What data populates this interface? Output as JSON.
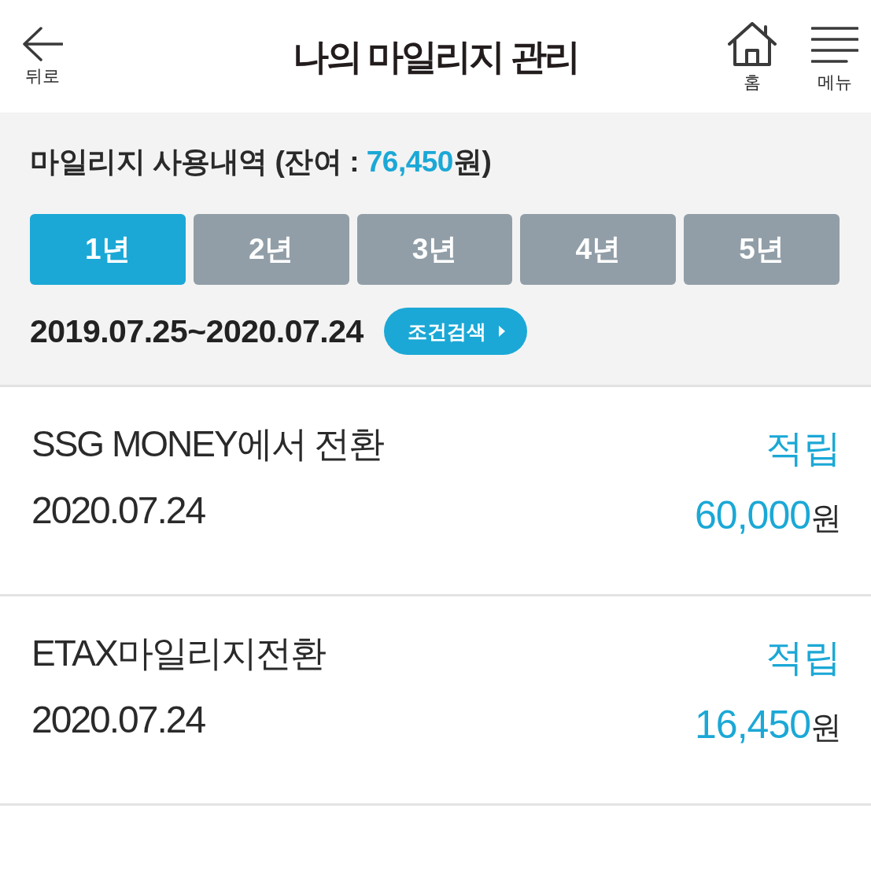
{
  "header": {
    "back_label": "뒤로",
    "title": "나의 마일리지 관리",
    "home_label": "홈",
    "menu_label": "메뉴"
  },
  "summary": {
    "heading": "마일리지 사용내역 (잔여 :",
    "balance": "76,450",
    "balance_end": "원)"
  },
  "periods": [
    {
      "label": "1년",
      "selected": true
    },
    {
      "label": "2년",
      "selected": false
    },
    {
      "label": "3년",
      "selected": false
    },
    {
      "label": "4년",
      "selected": false
    },
    {
      "label": "5년",
      "selected": false
    }
  ],
  "date_range": "2019.07.25~2020.07.24",
  "search_button": "조건검색",
  "transactions": [
    {
      "title": "SSG MONEY에서 전환",
      "date": "2020.07.24",
      "label": "적립",
      "amount": "60,000",
      "unit": "원"
    },
    {
      "title": "ETAX마일리지전환",
      "date": "2020.07.24",
      "label": "적립",
      "amount": "16,450",
      "unit": "원"
    }
  ]
}
